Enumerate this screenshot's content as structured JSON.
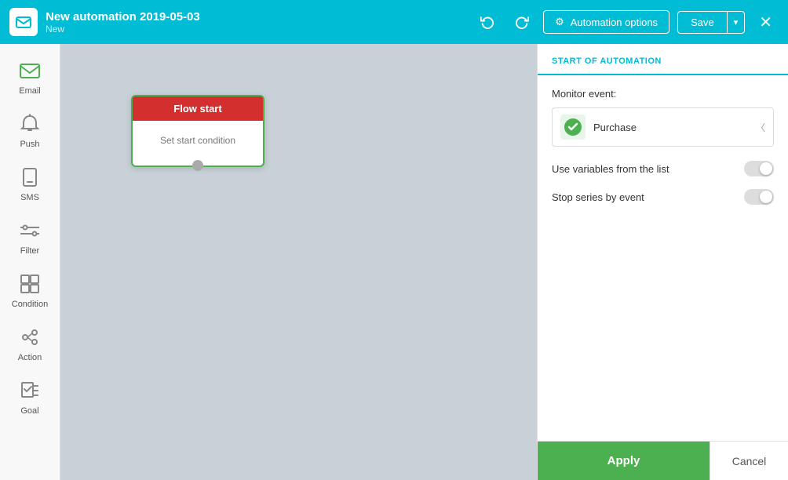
{
  "header": {
    "logo_icon": "✉",
    "title": "New automation 2019-05-03",
    "subtitle": "New",
    "undo_label": "↩",
    "redo_label": "↪",
    "automation_options_label": "Automation options",
    "gear_icon": "⚙",
    "save_label": "Save",
    "dropdown_icon": "▾",
    "close_icon": "✕"
  },
  "sidebar": {
    "items": [
      {
        "id": "email",
        "label": "Email",
        "icon": "✉"
      },
      {
        "id": "push",
        "label": "Push",
        "icon": "🔔"
      },
      {
        "id": "sms",
        "label": "SMS",
        "icon": "📱"
      },
      {
        "id": "filter",
        "label": "Filter",
        "icon": "⚡"
      },
      {
        "id": "condition",
        "label": "Condition",
        "icon": "⊞"
      },
      {
        "id": "action",
        "label": "Action",
        "icon": "⊕"
      },
      {
        "id": "goal",
        "label": "Goal",
        "icon": "⚑"
      }
    ]
  },
  "canvas": {
    "flow_card": {
      "header": "Flow start",
      "body": "Set start condition"
    }
  },
  "right_panel": {
    "section_title": "START OF AUTOMATION",
    "monitor_label": "Monitor event:",
    "event": {
      "name": "Purchase",
      "icon": "🧾"
    },
    "toggle1": {
      "label": "Use variables from the list",
      "enabled": false
    },
    "toggle2": {
      "label": "Stop series by event",
      "enabled": false
    },
    "apply_label": "Apply",
    "cancel_label": "Cancel"
  }
}
